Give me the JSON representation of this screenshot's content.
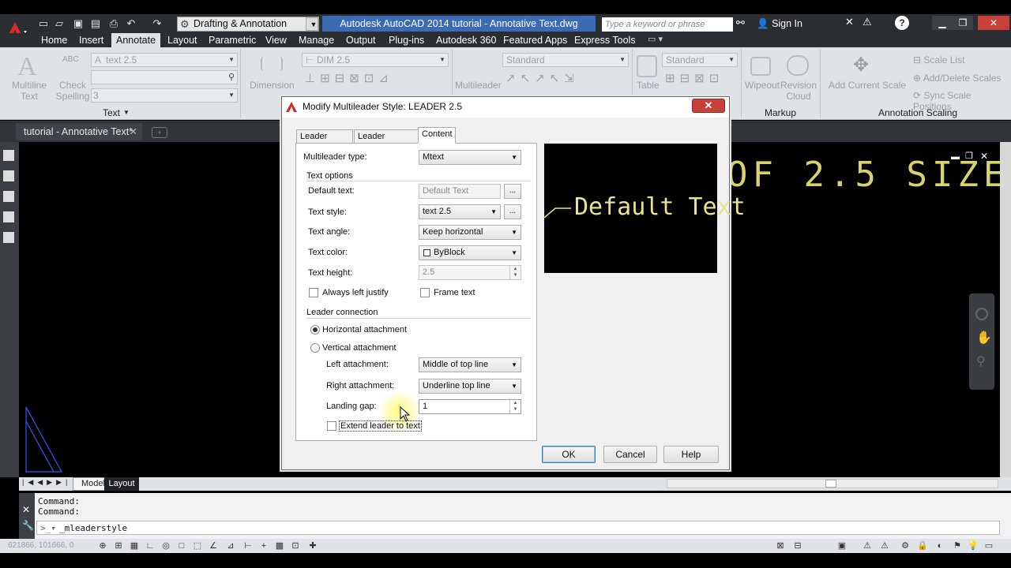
{
  "app": {
    "title": "Autodesk AutoCAD 2014    tutorial - Annotative Text.dwg",
    "workspace": "Drafting & Annotation",
    "search_placeholder": "Type a keyword or phrase",
    "sign_in": "Sign In",
    "help": "?"
  },
  "ribbon_tabs": [
    "Home",
    "Insert",
    "Annotate",
    "Layout",
    "Parametric",
    "View",
    "Manage",
    "Output",
    "Plug-ins",
    "Autodesk 360",
    "Featured Apps",
    "Express Tools"
  ],
  "ribbon": {
    "text_panel": {
      "multiline_text": "Multiline\nText",
      "check_spelling": "Check\nSpelling",
      "abc": "ABC",
      "text_style": "text 2.5",
      "text_height": "3",
      "label": "Text"
    },
    "dimension_panel": {
      "dimension": "Dimension",
      "dim_style": "DIM 2.5"
    },
    "leaders_panel": {
      "multileader": "Multileader",
      "style": "Standard"
    },
    "tables_panel": {
      "table": "Table",
      "style": "Standard"
    },
    "markup_panel": {
      "wipeout": "Wipeout",
      "revision_cloud": "Revision\nCloud",
      "label": "Markup"
    },
    "scaling_panel": {
      "add_current_scale": "Add Current Scale",
      "scale_list": "Scale List",
      "add_delete_scales": "Add/Delete Scales",
      "sync_scale_positions": "Sync Scale Positions",
      "label": "Annotation Scaling"
    }
  },
  "document_tab": "tutorial - Annotative Text*",
  "drawing_text": "OF 2.5 SIZE",
  "layout_tabs": {
    "model": "Model",
    "layout": "Layout"
  },
  "command_line": {
    "history": [
      "Command:",
      "Command:"
    ],
    "current": "_mleaderstyle"
  },
  "status": {
    "coordinates": "621866, 101666, 0"
  },
  "dialog": {
    "title": "Modify Multileader Style: LEADER 2.5",
    "tabs": [
      "Leader Format",
      "Leader Structure",
      "Content"
    ],
    "active_tab": "Content",
    "multileader_type_label": "Multileader type:",
    "multileader_type": "Mtext",
    "text_options_header": "Text options",
    "default_text_label": "Default text:",
    "default_text": "Default Text",
    "text_style_label": "Text style:",
    "text_style": "text 2.5",
    "text_angle_label": "Text angle:",
    "text_angle": "Keep horizontal",
    "text_color_label": "Text color:",
    "text_color": "ByBlock",
    "text_height_label": "Text height:",
    "text_height": "2.5",
    "always_left_justify": "Always left justify",
    "frame_text": "Frame text",
    "leader_connection_header": "Leader connection",
    "horizontal_attachment": "Horizontal attachment",
    "vertical_attachment": "Vertical attachment",
    "left_attachment_label": "Left attachment:",
    "left_attachment": "Middle of top line",
    "right_attachment_label": "Right attachment:",
    "right_attachment": "Underline top line",
    "landing_gap_label": "Landing gap:",
    "landing_gap": "1",
    "extend_leader": "Extend leader to text",
    "dots": "...",
    "preview_text": "Default Text",
    "ok": "OK",
    "cancel": "Cancel",
    "help": "Help"
  }
}
